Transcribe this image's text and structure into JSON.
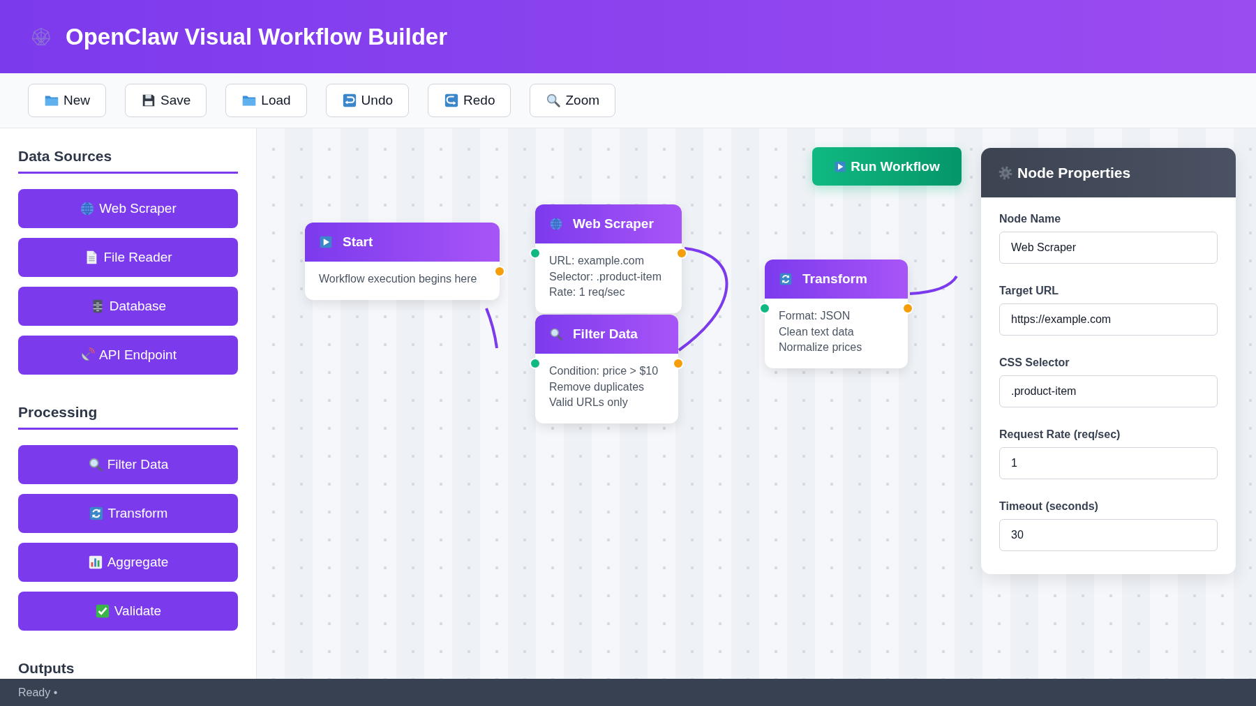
{
  "header": {
    "title": "OpenClaw Visual Workflow Builder"
  },
  "toolbar": [
    {
      "label": "New"
    },
    {
      "label": "Save"
    },
    {
      "label": "Load"
    },
    {
      "label": "Undo"
    },
    {
      "label": "Redo"
    },
    {
      "label": "Zoom"
    }
  ],
  "sidebar": {
    "sections": [
      {
        "title": "Data Sources",
        "items": [
          {
            "label": "Web Scraper"
          },
          {
            "label": "File Reader"
          },
          {
            "label": "Database"
          },
          {
            "label": "API Endpoint"
          }
        ]
      },
      {
        "title": "Processing",
        "items": [
          {
            "label": "Filter Data"
          },
          {
            "label": "Transform"
          },
          {
            "label": "Aggregate"
          },
          {
            "label": "Validate"
          }
        ]
      },
      {
        "title": "Outputs"
      }
    ]
  },
  "canvas": {
    "run_button": "Run Workflow",
    "nodes": [
      {
        "title": "Start",
        "input_port": false,
        "lines": [
          "Workflow execution begins here"
        ]
      },
      {
        "title": "Web Scraper",
        "input_port": true,
        "lines": [
          "URL: example.com",
          "Selector: .product-item",
          "Rate: 1 req/sec"
        ]
      },
      {
        "title": "Filter Data",
        "input_port": true,
        "lines": [
          "Condition: price > $10",
          "Remove duplicates",
          "Valid URLs only"
        ]
      },
      {
        "title": "Transform",
        "input_port": true,
        "lines": [
          "Format: JSON",
          "Clean text data",
          "Normalize prices"
        ]
      }
    ]
  },
  "properties": {
    "title": "Node Properties",
    "fields": [
      {
        "label": "Node Name",
        "value": "Web Scraper"
      },
      {
        "label": "Target URL",
        "value": "https://example.com"
      },
      {
        "label": "CSS Selector",
        "value": ".product-item"
      },
      {
        "label": "Request Rate (req/sec)",
        "value": "1"
      },
      {
        "label": "Timeout (seconds)",
        "value": "30"
      }
    ]
  },
  "status_bar": {
    "text": "Ready •"
  }
}
